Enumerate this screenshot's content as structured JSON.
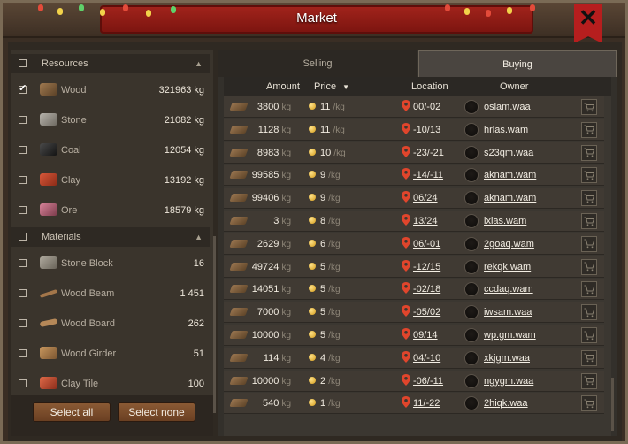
{
  "window": {
    "title": "Market"
  },
  "left_panel": {
    "resources_header": "Resources",
    "resources": [
      {
        "name": "Wood",
        "qty": "321963 kg",
        "checked": true,
        "icon": "wood-icon"
      },
      {
        "name": "Stone",
        "qty": "21082 kg",
        "checked": false,
        "icon": "stone-icon"
      },
      {
        "name": "Coal",
        "qty": "12054 kg",
        "checked": false,
        "icon": "coal-icon"
      },
      {
        "name": "Clay",
        "qty": "13192 kg",
        "checked": false,
        "icon": "clay-icon"
      },
      {
        "name": "Ore",
        "qty": "18579 kg",
        "checked": false,
        "icon": "ore-icon"
      }
    ],
    "materials_header": "Materials",
    "materials": [
      {
        "name": "Stone Block",
        "qty": "16",
        "checked": false,
        "icon": "stone-block-icon"
      },
      {
        "name": "Wood Beam",
        "qty": "1 451",
        "checked": false,
        "icon": "wood-beam-icon"
      },
      {
        "name": "Wood Board",
        "qty": "262",
        "checked": false,
        "icon": "wood-board-icon"
      },
      {
        "name": "Wood Girder",
        "qty": "51",
        "checked": false,
        "icon": "wood-girder-icon"
      },
      {
        "name": "Clay Tile",
        "qty": "100",
        "checked": false,
        "icon": "clay-tile-icon"
      }
    ],
    "select_all": "Select all",
    "select_none": "Select none"
  },
  "tabs": {
    "selling": "Selling",
    "buying": "Buying"
  },
  "table": {
    "columns": {
      "amount": "Amount",
      "price": "Price",
      "location": "Location",
      "owner": "Owner"
    },
    "unit_kg": "kg",
    "unit_per_kg": "/kg",
    "rows": [
      {
        "amount": "3800",
        "price": "11",
        "location": "00/-02",
        "owner": "oslam.waa"
      },
      {
        "amount": "1128",
        "price": "11",
        "location": "-10/13",
        "owner": "hrlas.wam"
      },
      {
        "amount": "8983",
        "price": "10",
        "location": "-23/-21",
        "owner": "s23qm.waa"
      },
      {
        "amount": "99585",
        "price": "9",
        "location": "-14/-11",
        "owner": "aknam.wam"
      },
      {
        "amount": "99406",
        "price": "9",
        "location": "06/24",
        "owner": "aknam.wam"
      },
      {
        "amount": "3",
        "price": "8",
        "location": "13/24",
        "owner": "ixias.wam"
      },
      {
        "amount": "2629",
        "price": "6",
        "location": "06/-01",
        "owner": "2goaq.wam"
      },
      {
        "amount": "49724",
        "price": "5",
        "location": "-12/15",
        "owner": "rekqk.wam"
      },
      {
        "amount": "14051",
        "price": "5",
        "location": "-02/18",
        "owner": "ccdaq.wam"
      },
      {
        "amount": "7000",
        "price": "5",
        "location": "-05/02",
        "owner": "iwsam.waa"
      },
      {
        "amount": "10000",
        "price": "5",
        "location": "09/14",
        "owner": "wp.gm.wam"
      },
      {
        "amount": "114",
        "price": "4",
        "location": "04/-10",
        "owner": "xkjgm.waa"
      },
      {
        "amount": "10000",
        "price": "2",
        "location": "-06/-11",
        "owner": "ngygm.waa"
      },
      {
        "amount": "540",
        "price": "1",
        "location": "11/-22",
        "owner": "2hiqk.waa"
      }
    ]
  },
  "colors": {
    "accent_red": "#b61e1e",
    "pin_red": "#e0452c",
    "coin_gold": "#e7b43a"
  }
}
